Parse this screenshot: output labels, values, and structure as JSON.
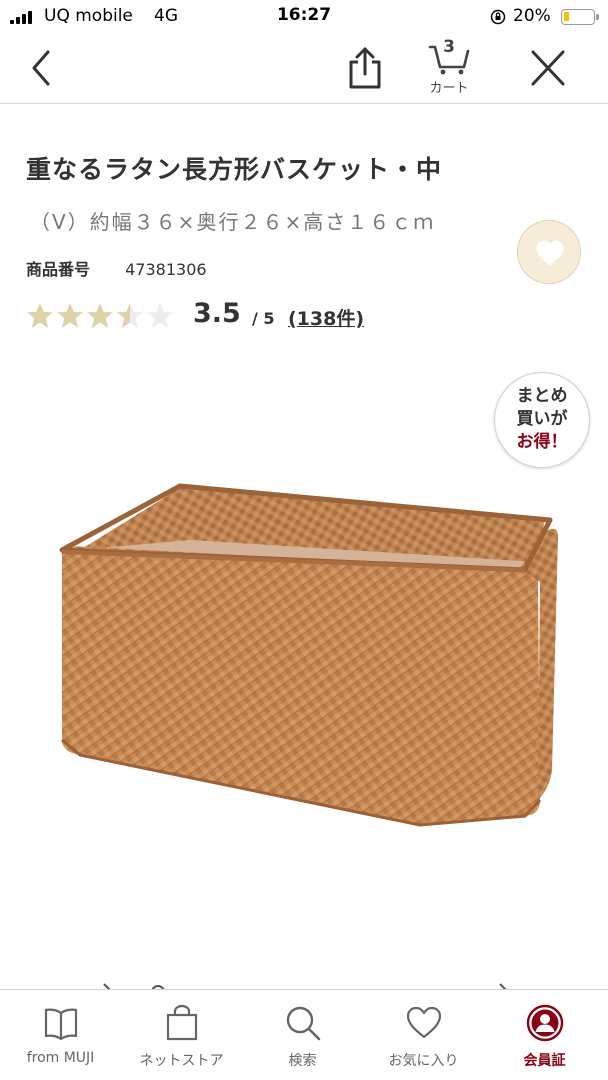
{
  "status_bar": {
    "carrier": "UQ mobile",
    "network": "4G",
    "time": "16:27",
    "battery_percent": "20%",
    "battery_level": 0.2
  },
  "nav": {
    "back_icon": "chevron-left-icon",
    "share_icon": "share-icon",
    "cart": {
      "count": "3",
      "label": "カート",
      "icon": "cart-icon"
    },
    "close_icon": "close-icon"
  },
  "product": {
    "title": "重なるラタン長方形バスケット・中",
    "variant": "（V）約幅３６×奥行２６×高さ１６ｃｍ",
    "sku_label": "商品番号",
    "sku": "47381306",
    "favorite_icon": "heart-icon",
    "rating": {
      "value": "3.5",
      "max": "/ 5",
      "stars": 3.5,
      "review_count": "(138件)"
    },
    "badge": {
      "line1": "まとめ",
      "line2": "買いが",
      "line3": "お得！"
    },
    "image_icon": "rattan-basket-image"
  },
  "tabs": [
    {
      "label": "from MUJI",
      "icon": "book-icon",
      "active": false
    },
    {
      "label": "ネットストア",
      "icon": "shopping-bag-icon",
      "active": false
    },
    {
      "label": "検索",
      "icon": "search-icon",
      "active": false
    },
    {
      "label": "お気に入り",
      "icon": "heart-icon",
      "active": false
    },
    {
      "label": "会員証",
      "icon": "member-card-icon",
      "active": true
    }
  ],
  "colors": {
    "accent": "#8b0012",
    "star_filled": "#e0d2a8",
    "star_empty": "#ededed",
    "favorite_bg": "#f6ecd8",
    "basket": "#c88a55"
  }
}
